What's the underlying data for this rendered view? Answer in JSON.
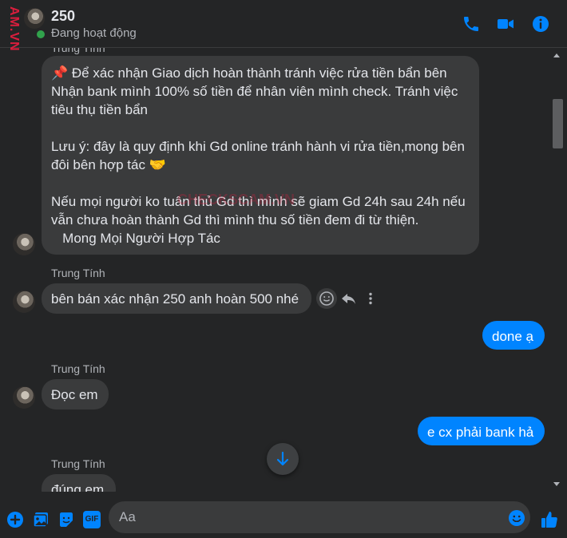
{
  "header": {
    "title": "250",
    "status": "Đang hoạt động",
    "watermark": "AM.VN",
    "icons": [
      "phone-icon",
      "video-icon",
      "info-icon"
    ]
  },
  "messages": {
    "m1": {
      "sender": "Trung Tính",
      "paragraph1": "📌 Để xác nhận Giao dịch hoàn thành tránh việc rửa tiền bẩn  bên Nhận bank mình 100% số tiền để nhân viên mình check. Tránh việc tiêu thụ tiền bẩn",
      "paragraph2": "Lưu ý: đây là quy định khi Gd online tránh hành vi rửa tiền,mong bên đôi bên hợp tác 🤝",
      "paragraph3": "Nếu mọi người ko tuân thủ Gd thì mình sẽ giam Gd 24h sau 24h nếu vẫn chưa hoàn thành Gd thì mình thu số tiền đem đi từ thiện.",
      "paragraph4": "   Mong Mọi Người Hợp Tác"
    },
    "m2": {
      "sender": "Trung Tính",
      "text": "bên bán xác nhận 250 anh hoàn 500 nhé"
    },
    "m3": {
      "text": "done ạ"
    },
    "m4": {
      "sender": "Trung Tính",
      "text": "Đọc em"
    },
    "m5": {
      "text": "e cx phải bank hả"
    },
    "m6": {
      "sender": "Trung Tính",
      "text": "đúng em"
    },
    "watermark": "CHECKSCAM.VN"
  },
  "composer": {
    "placeholder": "Aa",
    "icons": [
      "plus-icon",
      "photo-icon",
      "sticker-icon",
      "gif-icon",
      "emoji-icon",
      "like-icon"
    ],
    "gif_label": "GIF"
  },
  "colors": {
    "accent": "#0084ff",
    "background": "#242526",
    "bubble_in": "#3a3b3c",
    "online": "#31a24c"
  }
}
